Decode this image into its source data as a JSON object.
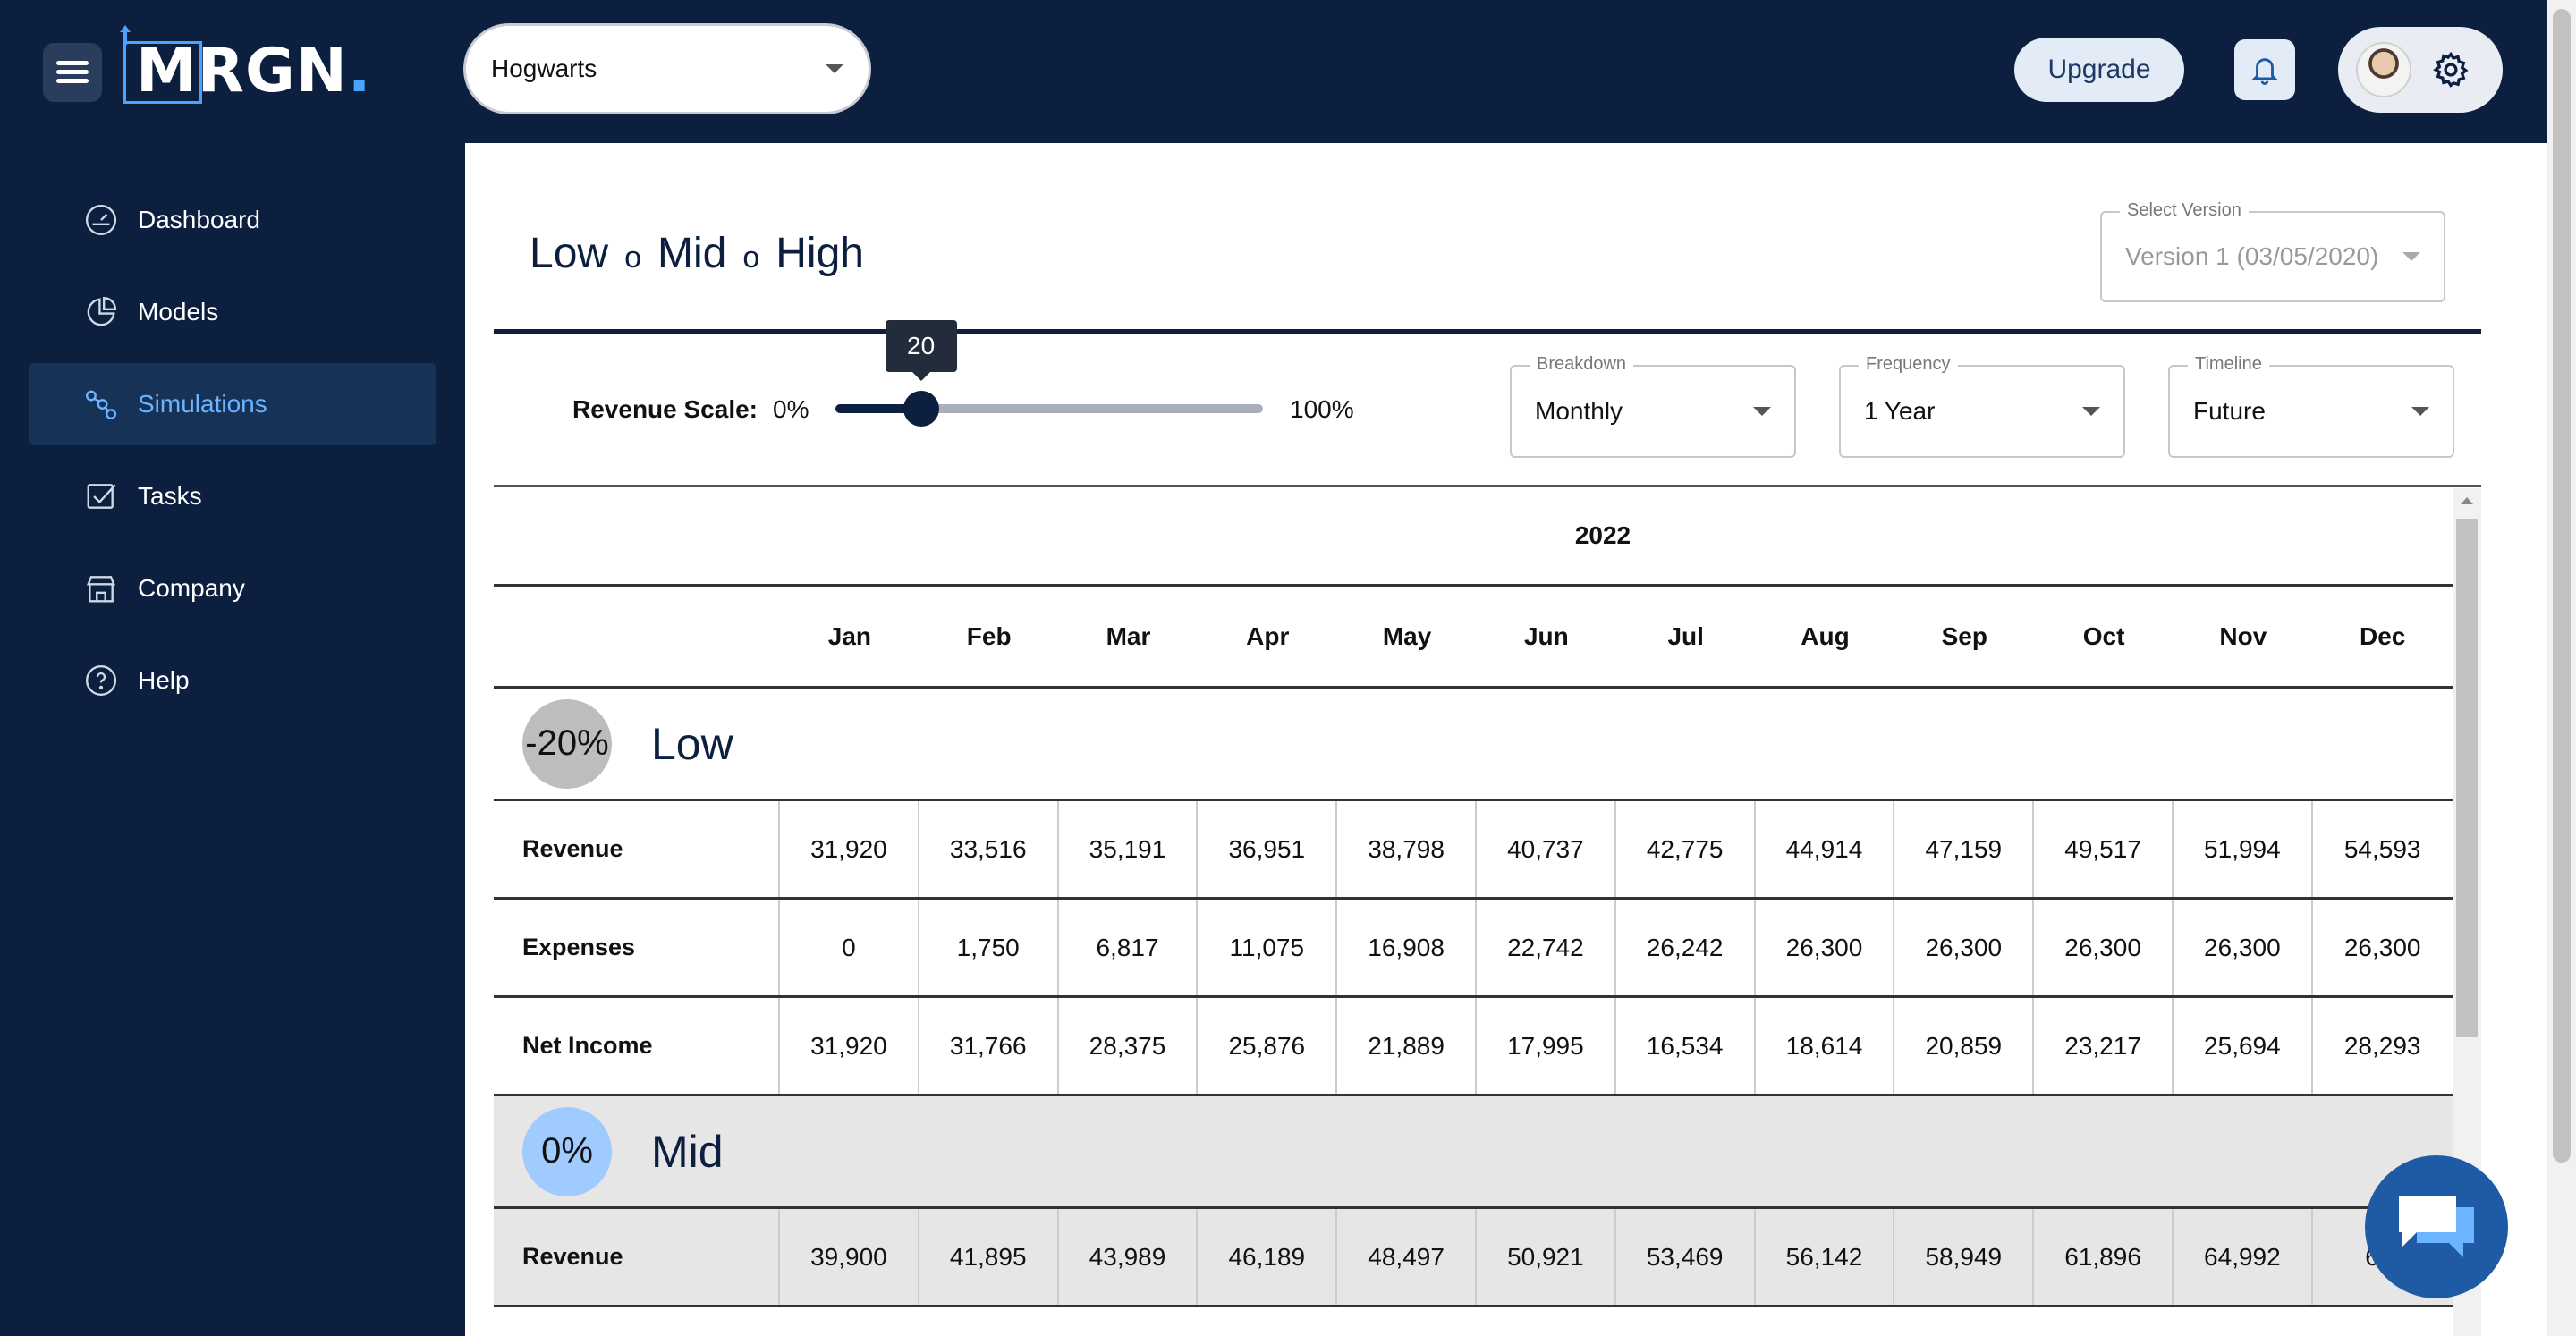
{
  "header": {
    "logo_text": "MRGN",
    "logo_dot": ".",
    "org_select": {
      "value": "Hogwarts"
    },
    "upgrade_label": "Upgrade"
  },
  "sidebar": {
    "items": [
      {
        "label": "Dashboard",
        "icon": "dashboard-icon",
        "active": false
      },
      {
        "label": "Models",
        "icon": "pie-chart-icon",
        "active": false
      },
      {
        "label": "Simulations",
        "icon": "simulations-icon",
        "active": true
      },
      {
        "label": "Tasks",
        "icon": "tasks-icon",
        "active": false
      },
      {
        "label": "Company",
        "icon": "company-icon",
        "active": false
      },
      {
        "label": "Help",
        "icon": "help-icon",
        "active": false
      }
    ]
  },
  "main": {
    "heading": {
      "low": "Low",
      "sep": "o",
      "mid": "Mid",
      "high": "High"
    },
    "version_select": {
      "label": "Select Version",
      "value": "Version 1 (03/05/2020)"
    },
    "revenue_scale": {
      "label": "Revenue Scale:",
      "min_label": "0%",
      "max_label": "100%",
      "value": 20,
      "value_label": "20"
    },
    "breakdown": {
      "label": "Breakdown",
      "value": "Monthly"
    },
    "frequency": {
      "label": "Frequency",
      "value": "1 Year"
    },
    "timeline": {
      "label": "Timeline",
      "value": "Future"
    },
    "table": {
      "year": "2022",
      "months": [
        "Jan",
        "Feb",
        "Mar",
        "Apr",
        "May",
        "Jun",
        "Jul",
        "Aug",
        "Sep",
        "Oct",
        "Nov",
        "Dec"
      ],
      "sections": [
        {
          "badge": "-20%",
          "title": "Low",
          "rows": [
            {
              "label": "Revenue",
              "values": [
                "31,920",
                "33,516",
                "35,191",
                "36,951",
                "38,798",
                "40,737",
                "42,775",
                "44,914",
                "47,159",
                "49,517",
                "51,994",
                "54,593"
              ]
            },
            {
              "label": "Expenses",
              "values": [
                "0",
                "1,750",
                "6,817",
                "11,075",
                "16,908",
                "22,742",
                "26,242",
                "26,300",
                "26,300",
                "26,300",
                "26,300",
                "26,300"
              ]
            },
            {
              "label": "Net Income",
              "values": [
                "31,920",
                "31,766",
                "28,375",
                "25,876",
                "21,889",
                "17,995",
                "16,534",
                "18,614",
                "20,859",
                "23,217",
                "25,694",
                "28,293"
              ]
            }
          ]
        },
        {
          "badge": "0%",
          "title": "Mid",
          "rows": [
            {
              "label": "Revenue",
              "values": [
                "39,900",
                "41,895",
                "43,989",
                "46,189",
                "48,497",
                "50,921",
                "53,469",
                "56,142",
                "58,949",
                "61,896",
                "64,992",
                "68,"
              ]
            }
          ]
        }
      ]
    }
  },
  "colors": {
    "navy": "#0c1f3f",
    "accent": "#4aa3ff",
    "active_nav_text": "#6cb4ff",
    "mid_badge": "#9fcbff",
    "low_badge": "#bdbdbd"
  }
}
